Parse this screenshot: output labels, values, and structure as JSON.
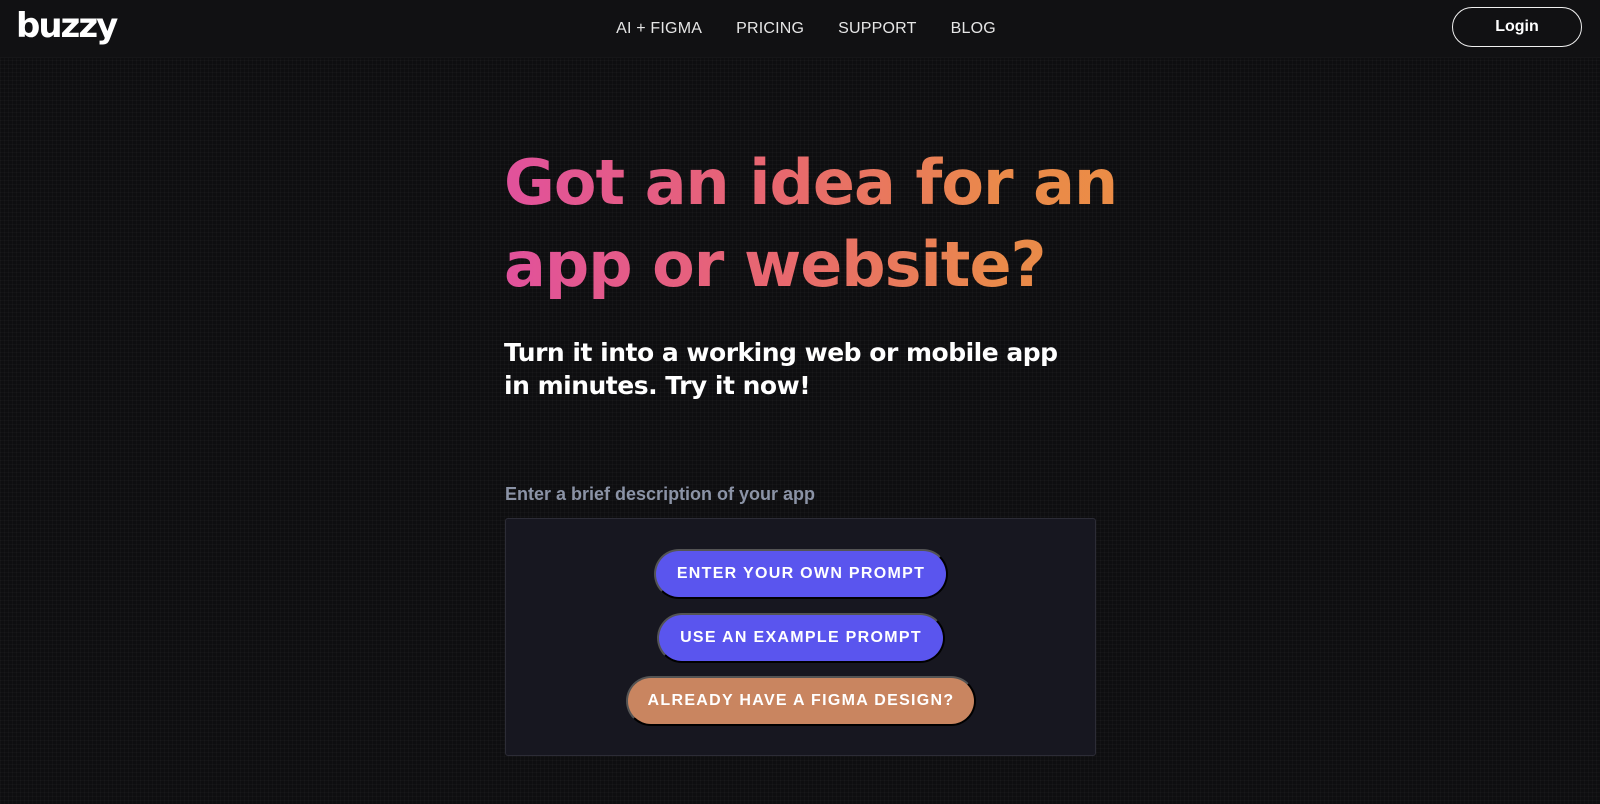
{
  "header": {
    "logo": "buzzy",
    "nav": [
      {
        "label": "AI + FIGMA"
      },
      {
        "label": "PRICING"
      },
      {
        "label": "SUPPORT"
      },
      {
        "label": "BLOG"
      }
    ],
    "login_label": "Login"
  },
  "hero": {
    "title": "Got an idea for an app or website?",
    "subtitle": "Turn it into a working web or mobile app in minutes. Try it now!"
  },
  "prompt": {
    "label": "Enter a brief description of your app",
    "buttons": {
      "own_prompt": "ENTER YOUR OWN PROMPT",
      "example_prompt": "USE AN EXAMPLE PROMPT",
      "figma_design": "ALREADY HAVE A FIGMA DESIGN?"
    }
  },
  "colors": {
    "background": "#0e0e10",
    "primary_button": "#5a55ee",
    "figma_button": "#c98560",
    "gradient_start": "#e1519c",
    "gradient_end": "#eb8c46"
  }
}
